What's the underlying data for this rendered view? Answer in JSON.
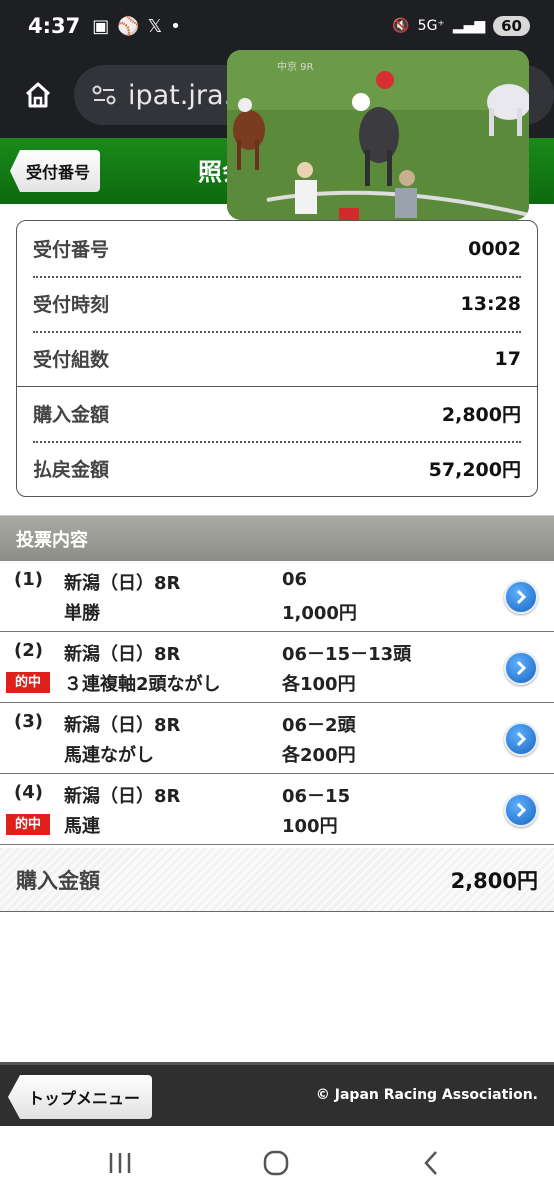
{
  "status_bar": {
    "time": "4:37",
    "network": "5G⁺",
    "battery": "60"
  },
  "browser": {
    "url": "ipat.jra.go.jp"
  },
  "header": {
    "back_label": "受付番号",
    "title": "照会"
  },
  "video": {
    "overlay_label": "中京 9R"
  },
  "summary": {
    "rows": [
      {
        "label": "受付番号",
        "value": "0002"
      },
      {
        "label": "受付時刻",
        "value": "13:28"
      },
      {
        "label": "受付組数",
        "value": "17"
      },
      {
        "label": "購入金額",
        "value": "2,800円"
      },
      {
        "label": "払戻金額",
        "value": "57,200円"
      }
    ]
  },
  "votes": {
    "header": "投票内容",
    "hit_badge": "的中",
    "items": [
      {
        "no": "(1)",
        "race": "新潟（日）8R",
        "type": "単勝",
        "combo": "06",
        "amount": "1,000円",
        "hit": false
      },
      {
        "no": "(2)",
        "race": "新潟（日）8R",
        "type": "３連複軸2頭ながし",
        "combo": "06－15－13頭",
        "amount": "各100円",
        "hit": true
      },
      {
        "no": "(3)",
        "race": "新潟（日）8R",
        "type": "馬連ながし",
        "combo": "06－2頭",
        "amount": "各200円",
        "hit": false
      },
      {
        "no": "(4)",
        "race": "新潟（日）8R",
        "type": "馬連",
        "combo": "06－15",
        "amount": "100円",
        "hit": true
      }
    ]
  },
  "total": {
    "label": "購入金額",
    "value": "2,800円"
  },
  "footer": {
    "top_menu": "トップメニュー",
    "copyright": "© Japan Racing Association."
  },
  "colors": {
    "header_green": "#0d6a0d",
    "hit_red": "#e0201a",
    "arrow_blue": "#1565c0"
  }
}
